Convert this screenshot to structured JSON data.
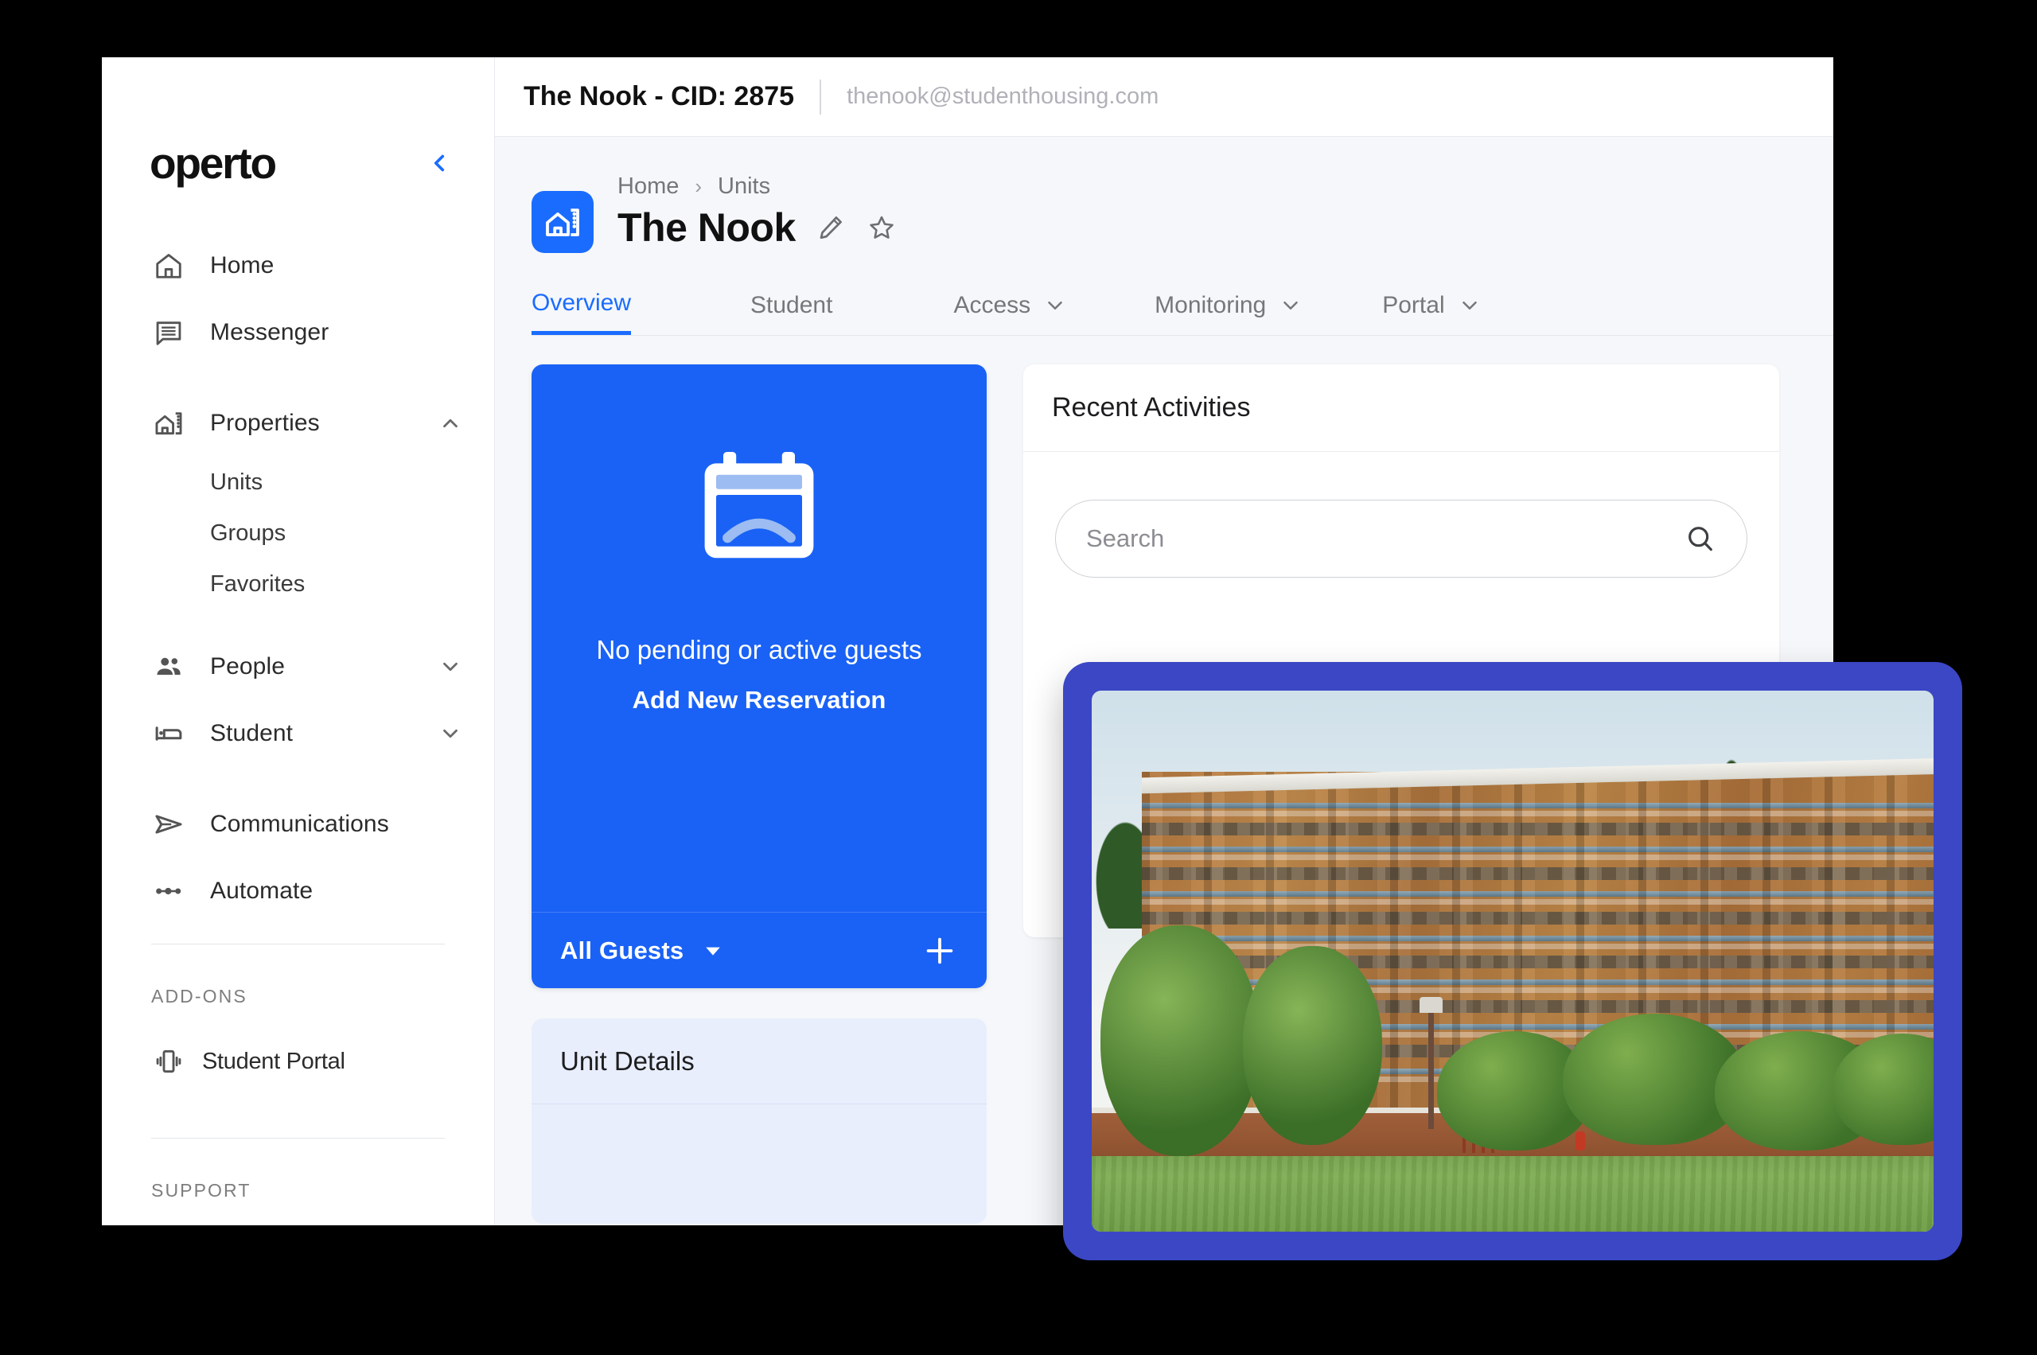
{
  "window": {
    "topbar": {
      "title": "The Nook - CID: 2875",
      "email": "thenook@studenthousing.com"
    }
  },
  "sidebar": {
    "brand": "operto",
    "collapse_icon": "chevron-left-icon",
    "nav": [
      {
        "label": "Home",
        "icon": "home-icon",
        "caret": ""
      },
      {
        "label": "Messenger",
        "icon": "message-icon",
        "caret": ""
      },
      {
        "label": "Properties",
        "icon": "building-icon",
        "caret": "chevron-up-icon"
      },
      {
        "label": "People",
        "icon": "people-icon",
        "caret": "chevron-down-icon"
      },
      {
        "label": "Student",
        "icon": "bed-icon",
        "caret": "chevron-down-icon"
      },
      {
        "label": "Communications",
        "icon": "send-icon",
        "caret": ""
      },
      {
        "label": "Automate",
        "icon": "automate-icon",
        "caret": ""
      }
    ],
    "properties_subitems": [
      "Units",
      "Groups",
      "Favorites"
    ],
    "sections": {
      "addons_label": "ADD-ONS",
      "support_label": "SUPPORT"
    },
    "addons": [
      {
        "label": "Student Portal",
        "icon": "phone-vibrate-icon"
      }
    ]
  },
  "page": {
    "avatar_icon": "unit-building-icon",
    "breadcrumb": [
      "Home",
      "Units"
    ],
    "breadcrumb_separator": "›",
    "title": "The Nook",
    "edit_icon": "pencil-icon",
    "favorite_icon": "star-outline-icon",
    "tabs": [
      {
        "label": "Overview",
        "active": true,
        "caret": false
      },
      {
        "label": "Student",
        "active": false,
        "caret": false
      },
      {
        "label": "Access",
        "active": false,
        "caret": true
      },
      {
        "label": "Monitoring",
        "active": false,
        "caret": true
      },
      {
        "label": "Portal",
        "active": false,
        "caret": true
      }
    ]
  },
  "guest_card": {
    "illustration_icon": "calendar-empty-icon",
    "empty_text": "No pending or active guests",
    "add_link": "Add New Reservation",
    "filter_label": "All Guests",
    "filter_caret_icon": "caret-down-icon",
    "add_button_icon": "plus-icon"
  },
  "unit_details_card": {
    "title": "Unit Details"
  },
  "activities_card": {
    "title": "Recent Activities",
    "search": {
      "value": "",
      "placeholder": "Search",
      "icon": "search-icon"
    }
  },
  "photo_overlay": {
    "alt": "student-housing-building-photo",
    "frame_color": "#3b47c4"
  },
  "colors": {
    "accent_blue": "#1a6cff",
    "card_blue": "#1a62f5",
    "overlay_border": "#3b47c4",
    "canvas": "#f5f7fa"
  }
}
